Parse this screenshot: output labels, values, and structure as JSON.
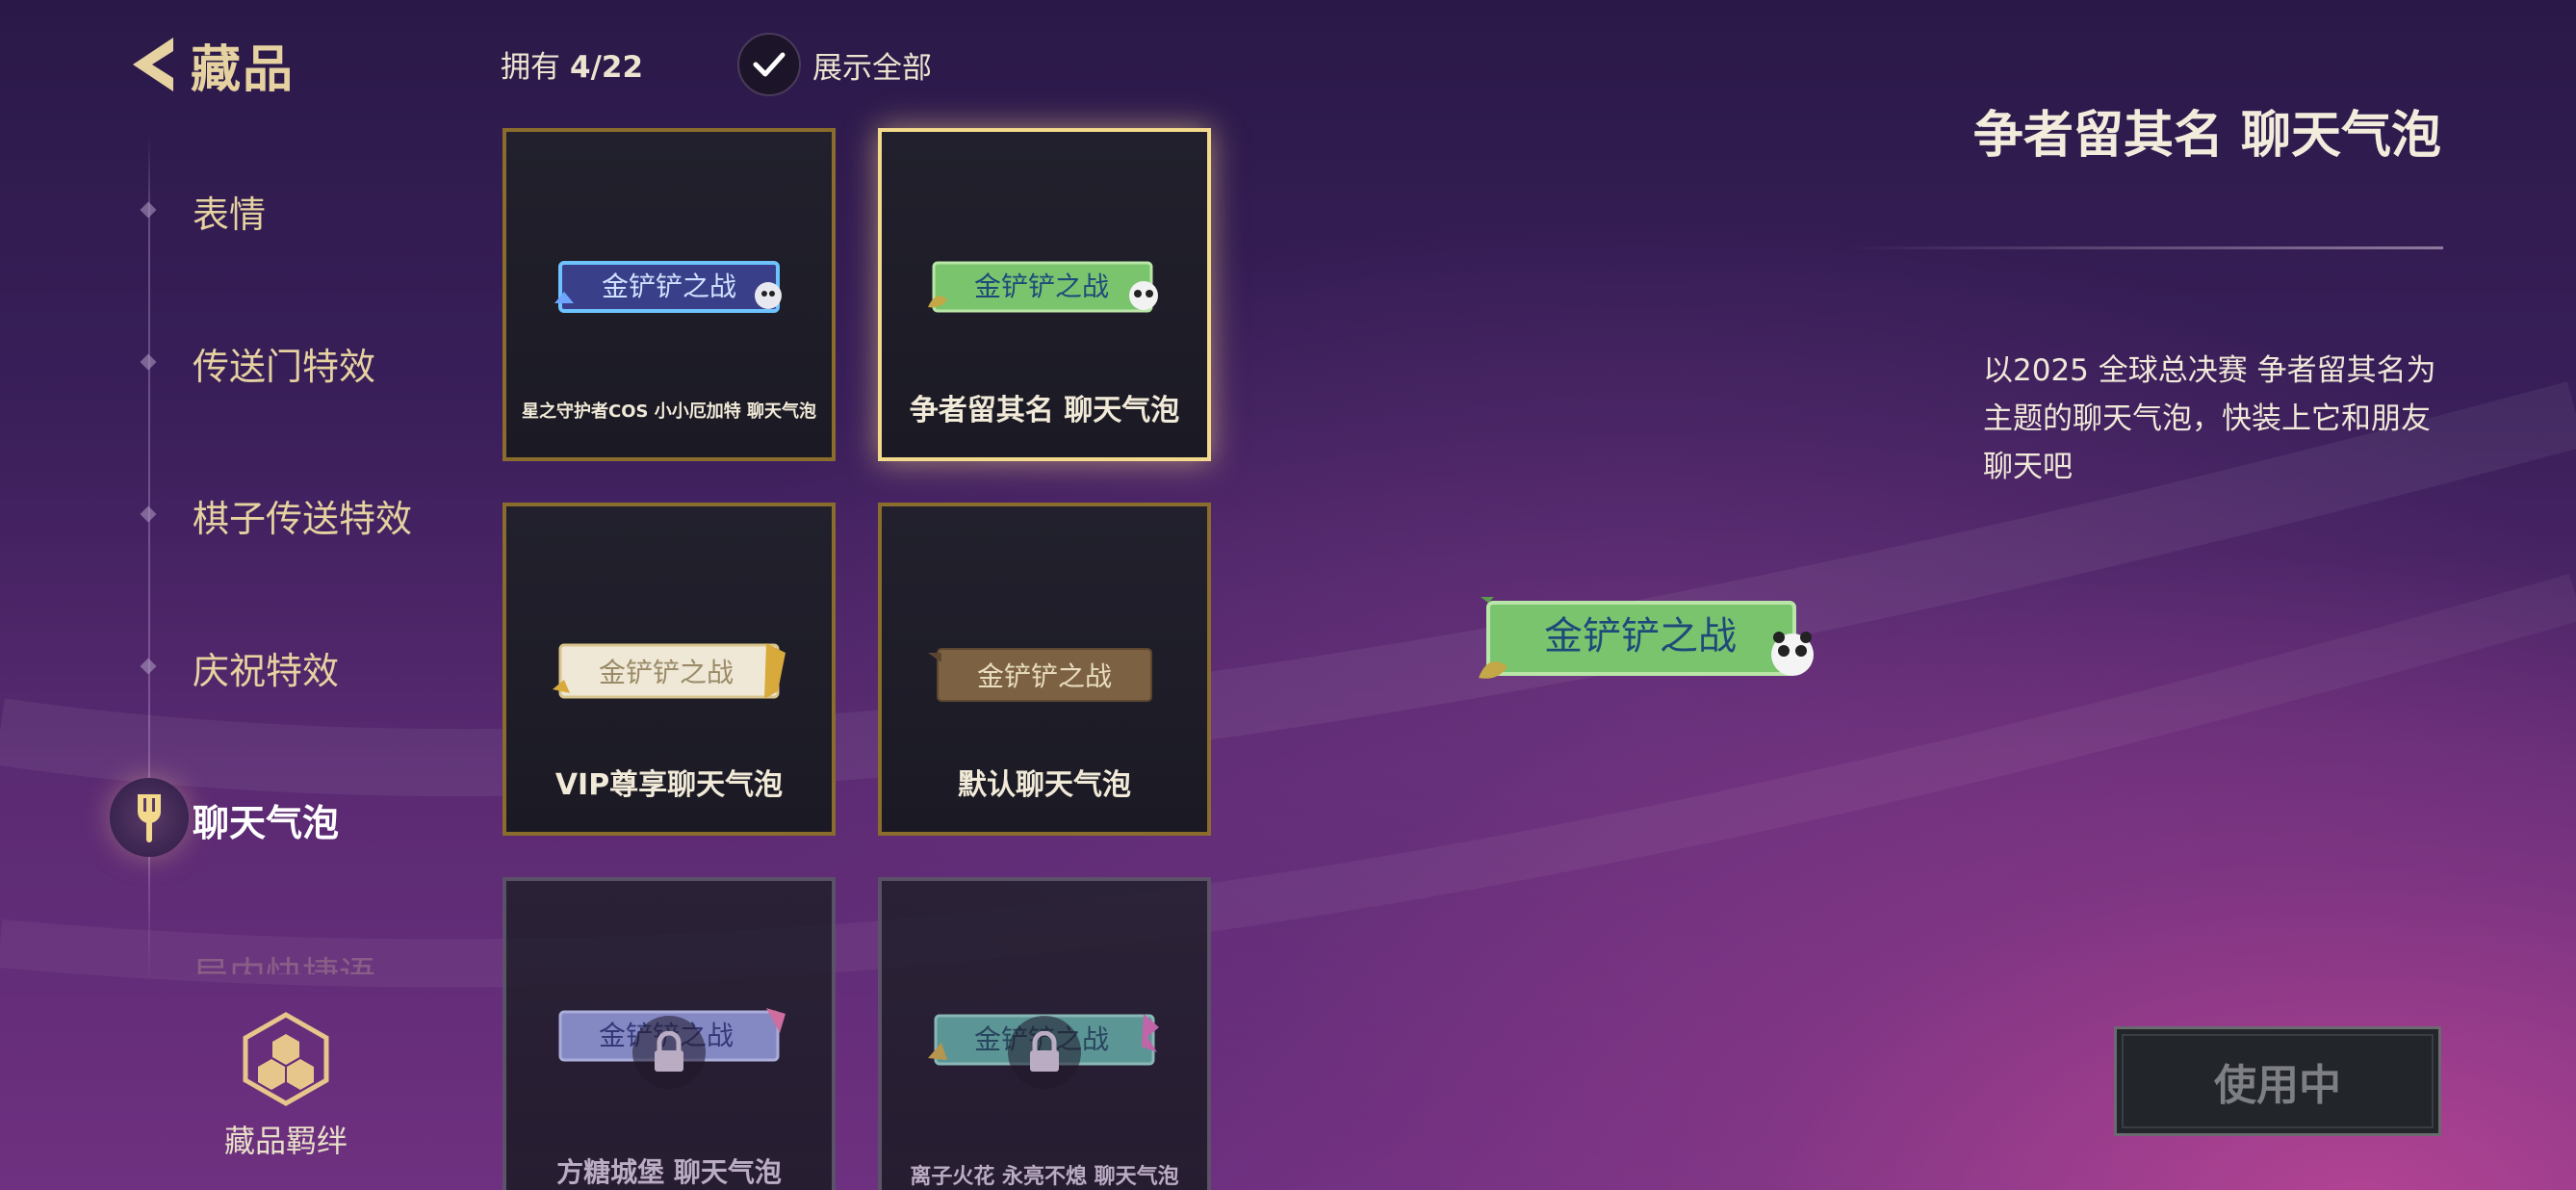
{
  "header": {
    "title": "藏品",
    "owned_label": "拥有",
    "owned_count": "4/22",
    "show_all_label": "展示全部",
    "show_all_checked": true
  },
  "sidebar": {
    "items": [
      {
        "label": "表情"
      },
      {
        "label": "传送门特效"
      },
      {
        "label": "棋子传送特效"
      },
      {
        "label": "庆祝特效"
      },
      {
        "label": "聊天气泡",
        "active": true
      },
      {
        "label": "局内快捷语",
        "partially_hidden": true
      }
    ],
    "bond_label": "藏品羁绊"
  },
  "grid": {
    "cards": [
      {
        "name": "星之守护者COS 小小厄加特 聊天气泡",
        "bubble_text": "金铲铲之战",
        "theme": "blue",
        "owned": true
      },
      {
        "name": "争者留其名 聊天气泡",
        "bubble_text": "金铲铲之战",
        "theme": "green",
        "owned": true,
        "selected": true
      },
      {
        "name": "VIP尊享聊天气泡",
        "bubble_text": "金铲铲之战",
        "theme": "cream",
        "owned": true
      },
      {
        "name": "默认聊天气泡",
        "bubble_text": "金铲铲之战",
        "theme": "brown",
        "owned": true
      },
      {
        "name": "方糖城堡 聊天气泡",
        "bubble_text": "金铲铲之战",
        "theme": "lavender",
        "owned": false
      },
      {
        "name": "离子火花 永亮不熄 聊天气泡",
        "bubble_text": "金铲铲之战",
        "theme": "teal",
        "owned": false
      }
    ]
  },
  "detail": {
    "title": "争者留其名 聊天气泡",
    "description": "以2025 全球总决赛 争者留其名为主题的聊天气泡，快装上它和朋友聊天吧",
    "preview_text": "金铲铲之战",
    "button_label": "使用中"
  },
  "colors": {
    "gold": "#e6d2a0",
    "selected_border": "#f3d98c",
    "card_border": "#8a6c2c"
  }
}
